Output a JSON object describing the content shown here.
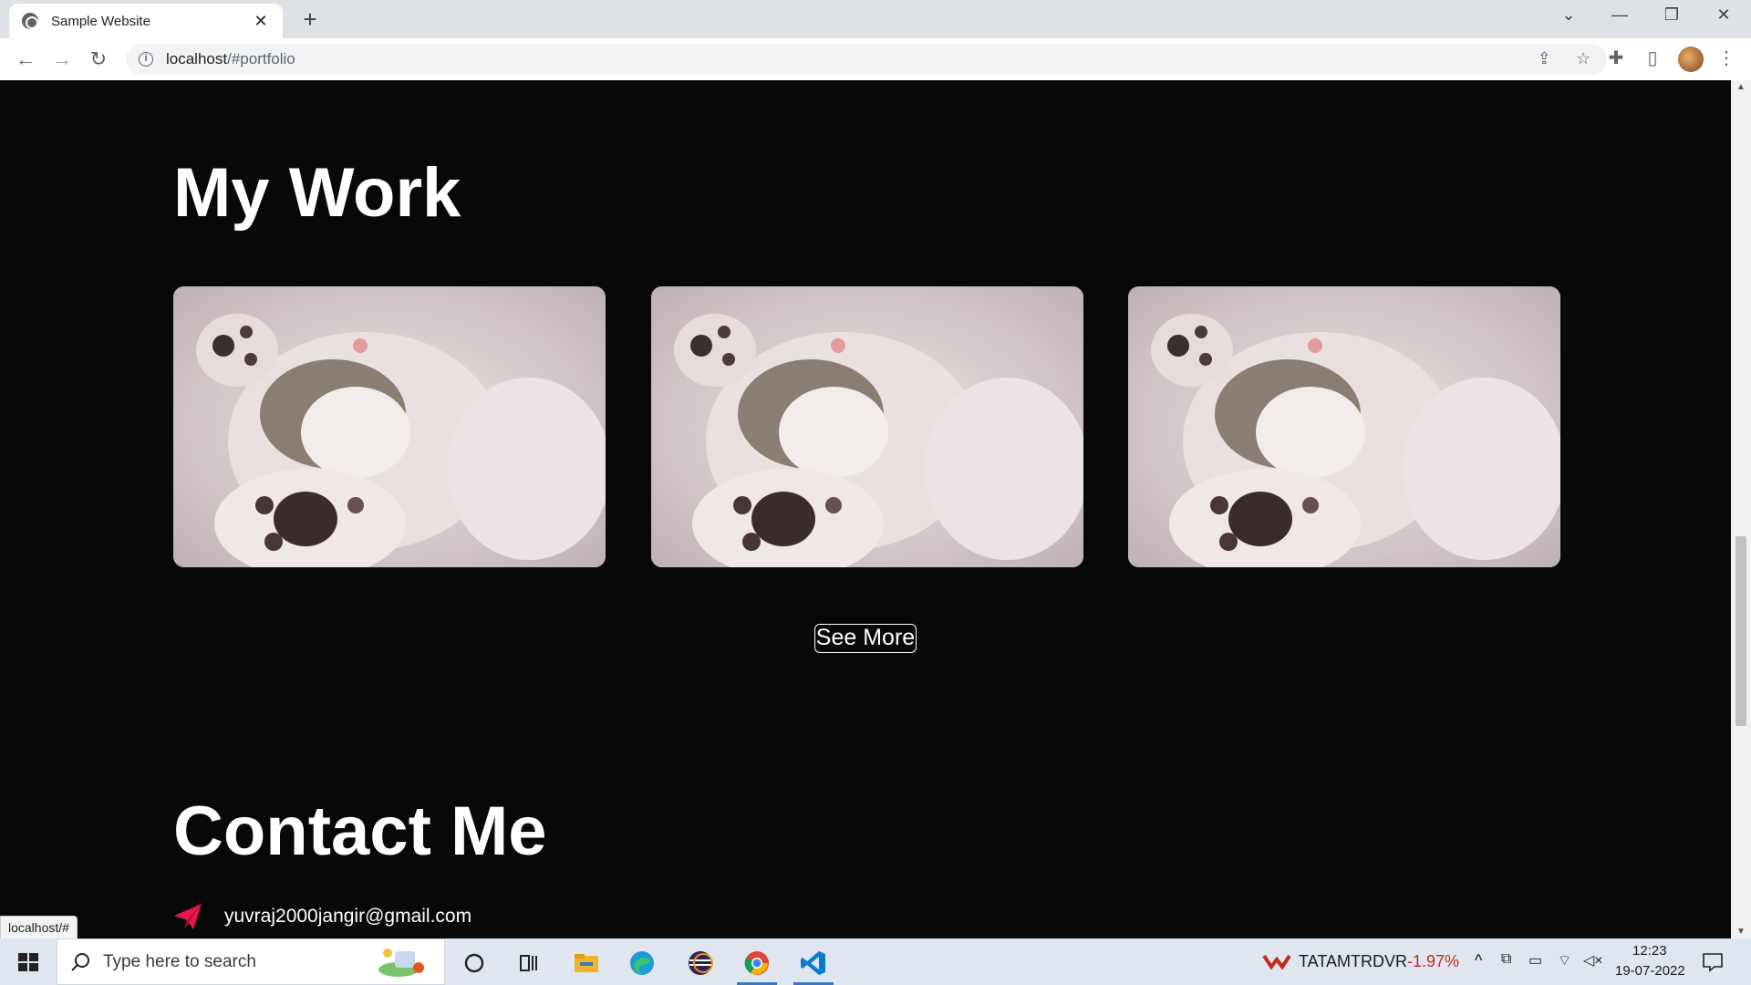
{
  "browser": {
    "tab_title": "Sample Website",
    "url_host": "localhost",
    "url_rest": "/#portfolio",
    "status_url": "localhost/#"
  },
  "page": {
    "work_heading": "My Work",
    "gallery": [
      {
        "alt": "sleeping kitten"
      },
      {
        "alt": "sleeping kitten"
      },
      {
        "alt": "sleeping kitten"
      }
    ],
    "see_more_label": "See More",
    "contact_heading": "Contact Me",
    "email": "yuvraj2000jangir@gmail.com"
  },
  "taskbar": {
    "search_placeholder": "Type here to search",
    "stock_ticker": "TATAMTRDVR",
    "stock_change": "-1.97%",
    "time": "12:23",
    "date": "19-07-2022"
  },
  "colors": {
    "page_bg": "#080808",
    "accent_icon": "#e8174a",
    "stock_negative": "#c42b1c"
  }
}
